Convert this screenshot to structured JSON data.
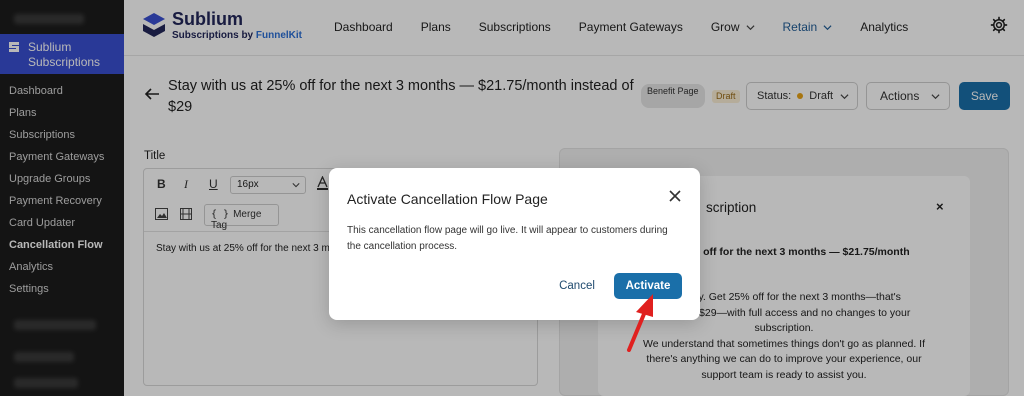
{
  "sidebar": {
    "plugin_label": "Sublium Subscriptions",
    "items": [
      {
        "label": "Dashboard"
      },
      {
        "label": "Plans"
      },
      {
        "label": "Subscriptions"
      },
      {
        "label": "Payment Gateways"
      },
      {
        "label": "Upgrade Groups"
      },
      {
        "label": "Payment Recovery"
      },
      {
        "label": "Card Updater"
      },
      {
        "label": "Cancellation Flow"
      },
      {
        "label": "Analytics"
      },
      {
        "label": "Settings"
      }
    ]
  },
  "brand": {
    "name": "Sublium",
    "tagline_prefix": "Subscriptions by ",
    "tagline_brand": "FunnelKit"
  },
  "nav": {
    "dashboard": "Dashboard",
    "plans": "Plans",
    "subscriptions": "Subscriptions",
    "payment_gateways": "Payment Gateways",
    "grow": "Grow",
    "retain": "Retain",
    "analytics": "Analytics"
  },
  "header": {
    "title": "Stay with us at 25% off for the next 3 months — $21.75/month instead of $29",
    "benefit_badge": "Benefit Page",
    "draft_badge": "Draft",
    "status_label": "Status:",
    "status_value": "Draft",
    "actions_label": "Actions",
    "save_label": "Save"
  },
  "editor": {
    "label": "Title",
    "bold": "B",
    "italic": "I",
    "underline": "U",
    "font_size": "16px",
    "merge_tag": "Merge Tag",
    "content": "Stay with us at 25% off for the next 3 m"
  },
  "preview": {
    "heading": "scription",
    "close": "×",
    "subtitle": "5% off for the next 3 months — $21.75/month",
    "body_line1": "u to stay. Get 25% off for the next 3 months—that's",
    "body_line2": "tead of $29—with full access and no changes to your",
    "body_line3": "subscription.",
    "body_line4": "We understand that sometimes things don't go as planned. If",
    "body_line5": "there's anything we can do to improve your experience, our",
    "body_line6": "support team is ready to assist you."
  },
  "modal": {
    "title": "Activate Cancellation Flow Page",
    "body": "This cancellation flow page will go live. It will appear to customers during the cancellation process.",
    "cancel_label": "Cancel",
    "activate_label": "Activate"
  },
  "colors": {
    "primary_button": "#1a6fa9",
    "sidebar_active": "#3a4fd1",
    "annotation_arrow": "#e0201f"
  }
}
